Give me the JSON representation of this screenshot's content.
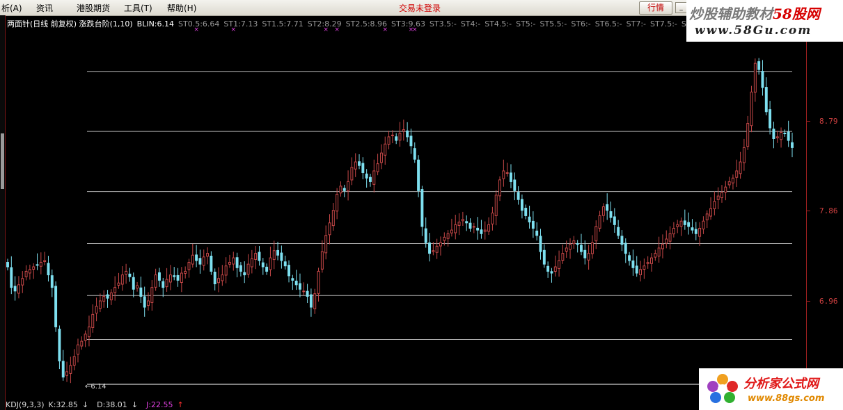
{
  "menu": {
    "items": [
      "析(A)",
      "资讯",
      "港股期货",
      "工具(T)",
      "帮助(H)"
    ],
    "login_status": "交易未登录",
    "quote_button": "行情",
    "minimize": "_",
    "restore": "▫"
  },
  "indicator": {
    "name": "两面针(日线 前复权) 涨跌台阶(1,10)",
    "blin": "BLIN:6.14",
    "steps": [
      "ST0.5:6.64",
      "ST1:7.13",
      "ST1.5:7.71",
      "ST2:8.29",
      "ST2.5:8.96",
      "ST3:9.63",
      "ST3.5:-",
      "ST4:-",
      "ST4.5:-",
      "ST5:-",
      "ST5.5:-",
      "ST6:-",
      "ST6.5:-",
      "ST7:-",
      "ST7.5:-",
      "S"
    ]
  },
  "price_axis": {
    "labels": [
      "8.79",
      "7.86",
      "6.96"
    ]
  },
  "low_label": "←6.14",
  "kdj": {
    "name": "KDJ(9,3,3)",
    "k": "K:32.85",
    "k_arrow": "↓",
    "d": "D:38.01",
    "d_arrow": "↓",
    "j": "J:22.55",
    "j_arrow": "↑"
  },
  "watermark_top": {
    "title_gray": "炒股辅助教材",
    "title_red": "58股网",
    "url": "www.58Gu.com"
  },
  "watermark_bottom": {
    "title": "分析家公式网",
    "url": "www.88gs.com"
  },
  "colors": {
    "up": "#c84848",
    "down": "#7ee0f0",
    "level": "#b4b4b4",
    "marker": "#e040e0",
    "axis": "#d04040"
  },
  "chart_data": {
    "type": "candlestick",
    "title": "两面针(日线 前复权) 涨跌台阶(1,10)",
    "ylim": [
      6.14,
      10.0
    ],
    "levels": [
      6.14,
      6.64,
      7.13,
      7.71,
      8.29,
      8.96,
      9.63
    ],
    "close_trend": [
      7.45,
      7.22,
      7.18,
      7.25,
      7.32,
      7.4,
      7.42,
      7.45,
      7.47,
      7.5,
      7.52,
      7.36,
      7.22,
      6.78,
      6.4,
      6.22,
      6.28,
      6.35,
      6.45,
      6.58,
      6.62,
      6.7,
      6.78,
      6.92,
      7.01,
      7.07,
      7.12,
      7.1,
      7.16,
      7.22,
      7.27,
      7.36,
      7.4,
      7.34,
      7.2,
      7.24,
      7.12,
      7.0,
      7.07,
      7.22,
      7.36,
      7.3,
      7.22,
      7.31,
      7.36,
      7.34,
      7.3,
      7.38,
      7.4,
      7.5,
      7.58,
      7.52,
      7.48,
      7.56,
      7.6,
      7.4,
      7.26,
      7.32,
      7.36,
      7.46,
      7.5,
      7.55,
      7.44,
      7.4,
      7.36,
      7.48,
      7.54,
      7.6,
      7.52,
      7.45,
      7.4,
      7.55,
      7.63,
      7.58,
      7.52,
      7.46,
      7.35,
      7.3,
      7.25,
      7.2,
      7.18,
      7.12,
      7.0,
      7.15,
      7.4,
      7.62,
      7.8,
      7.94,
      8.08,
      8.26,
      8.35,
      8.3,
      8.4,
      8.56,
      8.62,
      8.58,
      8.5,
      8.44,
      8.4,
      8.52,
      8.6,
      8.72,
      8.82,
      8.9,
      8.92,
      8.86,
      8.94,
      8.98,
      8.9,
      8.8,
      8.65,
      8.3,
      7.9,
      7.72,
      7.6,
      7.63,
      7.68,
      7.72,
      7.78,
      7.82,
      7.86,
      7.92,
      7.95,
      7.98,
      7.94,
      7.88,
      7.9,
      7.86,
      7.82,
      7.86,
      7.92,
      8.05,
      8.25,
      8.42,
      8.52,
      8.5,
      8.4,
      8.3,
      8.2,
      8.08,
      8.02,
      7.95,
      7.88,
      7.8,
      7.62,
      7.48,
      7.4,
      7.38,
      7.45,
      7.52,
      7.6,
      7.66,
      7.7,
      7.74,
      7.7,
      7.62,
      7.55,
      7.6,
      7.72,
      7.9,
      8.02,
      8.12,
      8.08,
      8.0,
      7.92,
      7.8,
      7.7,
      7.6,
      7.52,
      7.44,
      7.38,
      7.42,
      7.46,
      7.5,
      7.55,
      7.6,
      7.66,
      7.7,
      7.76,
      7.82,
      7.88,
      7.92,
      7.96,
      7.92,
      7.9,
      7.86,
      7.82,
      7.88,
      7.96,
      8.04,
      8.1,
      8.18,
      8.24,
      8.28,
      8.34,
      8.4,
      8.44,
      8.52,
      8.62,
      8.78,
      9.05,
      9.4,
      9.72,
      9.65,
      9.45,
      9.18,
      9.0,
      8.88,
      8.9,
      8.95,
      8.94,
      8.86,
      8.78
    ],
    "markers_x_index": [
      51,
      61,
      86,
      89,
      102,
      109,
      110
    ]
  }
}
